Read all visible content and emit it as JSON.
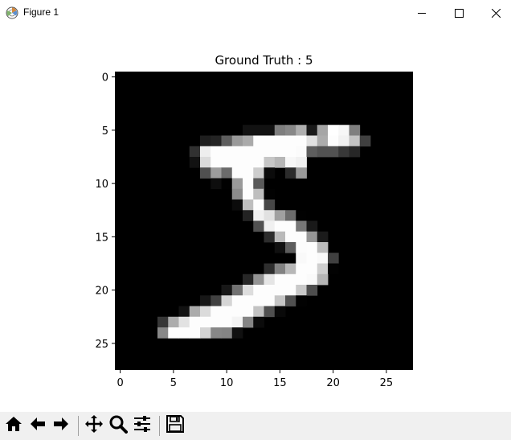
{
  "window": {
    "title": "Figure 1",
    "icons": {
      "app": "matplotlib-figure-icon",
      "minimize": "minimize-icon",
      "maximize": "maximize-icon",
      "close": "close-icon"
    }
  },
  "figure": {
    "title": "Ground Truth : 5"
  },
  "toolbar": {
    "buttons": [
      {
        "name": "home-icon"
      },
      {
        "name": "back-arrow-icon"
      },
      {
        "name": "forward-arrow-icon"
      },
      {
        "name": "pan-icon"
      },
      {
        "name": "zoom-icon"
      },
      {
        "name": "configure-subplots-icon"
      },
      {
        "name": "save-icon"
      }
    ]
  },
  "chart_data": {
    "type": "heatmap",
    "title": "Ground Truth : 5",
    "colormap": "gray",
    "shape": [
      28,
      28
    ],
    "xticks": [
      0,
      5,
      10,
      15,
      20,
      25
    ],
    "yticks": [
      0,
      5,
      10,
      15,
      20,
      25
    ],
    "xlim": [
      -0.5,
      27.5
    ],
    "ylim": [
      27.5,
      -0.5
    ],
    "grid": false,
    "background_value": 0,
    "nonzero_pixels": [
      {
        "row": 5,
        "col": 12,
        "v": 18
      },
      {
        "row": 5,
        "col": 13,
        "v": 18
      },
      {
        "row": 5,
        "col": 14,
        "v": 18
      },
      {
        "row": 5,
        "col": 15,
        "v": 126
      },
      {
        "row": 5,
        "col": 16,
        "v": 136
      },
      {
        "row": 5,
        "col": 17,
        "v": 175
      },
      {
        "row": 5,
        "col": 18,
        "v": 26
      },
      {
        "row": 5,
        "col": 19,
        "v": 166
      },
      {
        "row": 5,
        "col": 20,
        "v": 255
      },
      {
        "row": 5,
        "col": 21,
        "v": 247
      },
      {
        "row": 5,
        "col": 22,
        "v": 127
      },
      {
        "row": 6,
        "col": 8,
        "v": 30
      },
      {
        "row": 6,
        "col": 9,
        "v": 36
      },
      {
        "row": 6,
        "col": 10,
        "v": 94
      },
      {
        "row": 6,
        "col": 11,
        "v": 154
      },
      {
        "row": 6,
        "col": 12,
        "v": 170
      },
      {
        "row": 6,
        "col": 13,
        "v": 253
      },
      {
        "row": 6,
        "col": 14,
        "v": 253
      },
      {
        "row": 6,
        "col": 15,
        "v": 253
      },
      {
        "row": 6,
        "col": 16,
        "v": 253
      },
      {
        "row": 6,
        "col": 17,
        "v": 253
      },
      {
        "row": 6,
        "col": 18,
        "v": 225
      },
      {
        "row": 6,
        "col": 19,
        "v": 172
      },
      {
        "row": 6,
        "col": 20,
        "v": 253
      },
      {
        "row": 6,
        "col": 21,
        "v": 242
      },
      {
        "row": 6,
        "col": 22,
        "v": 195
      },
      {
        "row": 6,
        "col": 23,
        "v": 64
      },
      {
        "row": 7,
        "col": 7,
        "v": 49
      },
      {
        "row": 7,
        "col": 8,
        "v": 238
      },
      {
        "row": 7,
        "col": 9,
        "v": 253
      },
      {
        "row": 7,
        "col": 10,
        "v": 253
      },
      {
        "row": 7,
        "col": 11,
        "v": 253
      },
      {
        "row": 7,
        "col": 12,
        "v": 253
      },
      {
        "row": 7,
        "col": 13,
        "v": 253
      },
      {
        "row": 7,
        "col": 14,
        "v": 253
      },
      {
        "row": 7,
        "col": 15,
        "v": 253
      },
      {
        "row": 7,
        "col": 16,
        "v": 253
      },
      {
        "row": 7,
        "col": 17,
        "v": 251
      },
      {
        "row": 7,
        "col": 18,
        "v": 93
      },
      {
        "row": 7,
        "col": 19,
        "v": 82
      },
      {
        "row": 7,
        "col": 20,
        "v": 82
      },
      {
        "row": 7,
        "col": 21,
        "v": 56
      },
      {
        "row": 7,
        "col": 22,
        "v": 39
      },
      {
        "row": 8,
        "col": 7,
        "v": 18
      },
      {
        "row": 8,
        "col": 8,
        "v": 219
      },
      {
        "row": 8,
        "col": 9,
        "v": 253
      },
      {
        "row": 8,
        "col": 10,
        "v": 253
      },
      {
        "row": 8,
        "col": 11,
        "v": 253
      },
      {
        "row": 8,
        "col": 12,
        "v": 253
      },
      {
        "row": 8,
        "col": 13,
        "v": 253
      },
      {
        "row": 8,
        "col": 14,
        "v": 198
      },
      {
        "row": 8,
        "col": 15,
        "v": 182
      },
      {
        "row": 8,
        "col": 16,
        "v": 247
      },
      {
        "row": 8,
        "col": 17,
        "v": 241
      },
      {
        "row": 9,
        "col": 8,
        "v": 80
      },
      {
        "row": 9,
        "col": 9,
        "v": 156
      },
      {
        "row": 9,
        "col": 10,
        "v": 107
      },
      {
        "row": 9,
        "col": 11,
        "v": 253
      },
      {
        "row": 9,
        "col": 12,
        "v": 253
      },
      {
        "row": 9,
        "col": 13,
        "v": 205
      },
      {
        "row": 9,
        "col": 14,
        "v": 11
      },
      {
        "row": 9,
        "col": 16,
        "v": 43
      },
      {
        "row": 9,
        "col": 17,
        "v": 154
      },
      {
        "row": 10,
        "col": 9,
        "v": 14
      },
      {
        "row": 10,
        "col": 10,
        "v": 1
      },
      {
        "row": 10,
        "col": 11,
        "v": 154
      },
      {
        "row": 10,
        "col": 12,
        "v": 253
      },
      {
        "row": 10,
        "col": 13,
        "v": 90
      },
      {
        "row": 11,
        "col": 11,
        "v": 139
      },
      {
        "row": 11,
        "col": 12,
        "v": 253
      },
      {
        "row": 11,
        "col": 13,
        "v": 190
      },
      {
        "row": 11,
        "col": 14,
        "v": 2
      },
      {
        "row": 12,
        "col": 11,
        "v": 11
      },
      {
        "row": 12,
        "col": 12,
        "v": 190
      },
      {
        "row": 12,
        "col": 13,
        "v": 253
      },
      {
        "row": 12,
        "col": 14,
        "v": 70
      },
      {
        "row": 13,
        "col": 12,
        "v": 35
      },
      {
        "row": 13,
        "col": 13,
        "v": 241
      },
      {
        "row": 13,
        "col": 14,
        "v": 225
      },
      {
        "row": 13,
        "col": 15,
        "v": 160
      },
      {
        "row": 13,
        "col": 16,
        "v": 108
      },
      {
        "row": 13,
        "col": 17,
        "v": 1
      },
      {
        "row": 14,
        "col": 13,
        "v": 81
      },
      {
        "row": 14,
        "col": 14,
        "v": 240
      },
      {
        "row": 14,
        "col": 15,
        "v": 253
      },
      {
        "row": 14,
        "col": 16,
        "v": 253
      },
      {
        "row": 14,
        "col": 17,
        "v": 119
      },
      {
        "row": 14,
        "col": 18,
        "v": 25
      },
      {
        "row": 15,
        "col": 14,
        "v": 45
      },
      {
        "row": 15,
        "col": 15,
        "v": 186
      },
      {
        "row": 15,
        "col": 16,
        "v": 253
      },
      {
        "row": 15,
        "col": 17,
        "v": 253
      },
      {
        "row": 15,
        "col": 18,
        "v": 150
      },
      {
        "row": 15,
        "col": 19,
        "v": 27
      },
      {
        "row": 16,
        "col": 15,
        "v": 16
      },
      {
        "row": 16,
        "col": 16,
        "v": 93
      },
      {
        "row": 16,
        "col": 17,
        "v": 252
      },
      {
        "row": 16,
        "col": 18,
        "v": 253
      },
      {
        "row": 16,
        "col": 19,
        "v": 187
      },
      {
        "row": 17,
        "col": 17,
        "v": 249
      },
      {
        "row": 17,
        "col": 18,
        "v": 253
      },
      {
        "row": 17,
        "col": 19,
        "v": 249
      },
      {
        "row": 17,
        "col": 20,
        "v": 64
      },
      {
        "row": 18,
        "col": 14,
        "v": 46
      },
      {
        "row": 18,
        "col": 15,
        "v": 130
      },
      {
        "row": 18,
        "col": 16,
        "v": 183
      },
      {
        "row": 18,
        "col": 17,
        "v": 253
      },
      {
        "row": 18,
        "col": 18,
        "v": 253
      },
      {
        "row": 18,
        "col": 19,
        "v": 207
      },
      {
        "row": 18,
        "col": 20,
        "v": 2
      },
      {
        "row": 19,
        "col": 12,
        "v": 39
      },
      {
        "row": 19,
        "col": 13,
        "v": 148
      },
      {
        "row": 19,
        "col": 14,
        "v": 229
      },
      {
        "row": 19,
        "col": 15,
        "v": 253
      },
      {
        "row": 19,
        "col": 16,
        "v": 253
      },
      {
        "row": 19,
        "col": 17,
        "v": 253
      },
      {
        "row": 19,
        "col": 18,
        "v": 250
      },
      {
        "row": 19,
        "col": 19,
        "v": 182
      },
      {
        "row": 20,
        "col": 10,
        "v": 24
      },
      {
        "row": 20,
        "col": 11,
        "v": 114
      },
      {
        "row": 20,
        "col": 12,
        "v": 221
      },
      {
        "row": 20,
        "col": 13,
        "v": 253
      },
      {
        "row": 20,
        "col": 14,
        "v": 253
      },
      {
        "row": 20,
        "col": 15,
        "v": 253
      },
      {
        "row": 20,
        "col": 16,
        "v": 253
      },
      {
        "row": 20,
        "col": 17,
        "v": 201
      },
      {
        "row": 20,
        "col": 18,
        "v": 78
      },
      {
        "row": 21,
        "col": 8,
        "v": 23
      },
      {
        "row": 21,
        "col": 9,
        "v": 66
      },
      {
        "row": 21,
        "col": 10,
        "v": 213
      },
      {
        "row": 21,
        "col": 11,
        "v": 253
      },
      {
        "row": 21,
        "col": 12,
        "v": 253
      },
      {
        "row": 21,
        "col": 13,
        "v": 253
      },
      {
        "row": 21,
        "col": 14,
        "v": 253
      },
      {
        "row": 21,
        "col": 15,
        "v": 198
      },
      {
        "row": 21,
        "col": 16,
        "v": 81
      },
      {
        "row": 21,
        "col": 17,
        "v": 2
      },
      {
        "row": 22,
        "col": 6,
        "v": 18
      },
      {
        "row": 22,
        "col": 7,
        "v": 171
      },
      {
        "row": 22,
        "col": 8,
        "v": 219
      },
      {
        "row": 22,
        "col": 9,
        "v": 253
      },
      {
        "row": 22,
        "col": 10,
        "v": 253
      },
      {
        "row": 22,
        "col": 11,
        "v": 253
      },
      {
        "row": 22,
        "col": 12,
        "v": 253
      },
      {
        "row": 22,
        "col": 13,
        "v": 195
      },
      {
        "row": 22,
        "col": 14,
        "v": 80
      },
      {
        "row": 22,
        "col": 15,
        "v": 9
      },
      {
        "row": 23,
        "col": 4,
        "v": 55
      },
      {
        "row": 23,
        "col": 5,
        "v": 172
      },
      {
        "row": 23,
        "col": 6,
        "v": 226
      },
      {
        "row": 23,
        "col": 7,
        "v": 253
      },
      {
        "row": 23,
        "col": 8,
        "v": 253
      },
      {
        "row": 23,
        "col": 9,
        "v": 253
      },
      {
        "row": 23,
        "col": 10,
        "v": 253
      },
      {
        "row": 23,
        "col": 11,
        "v": 244
      },
      {
        "row": 23,
        "col": 12,
        "v": 133
      },
      {
        "row": 23,
        "col": 13,
        "v": 11
      },
      {
        "row": 24,
        "col": 4,
        "v": 136
      },
      {
        "row": 24,
        "col": 5,
        "v": 253
      },
      {
        "row": 24,
        "col": 6,
        "v": 253
      },
      {
        "row": 24,
        "col": 7,
        "v": 253
      },
      {
        "row": 24,
        "col": 8,
        "v": 212
      },
      {
        "row": 24,
        "col": 9,
        "v": 135
      },
      {
        "row": 24,
        "col": 10,
        "v": 132
      },
      {
        "row": 24,
        "col": 11,
        "v": 16
      }
    ]
  }
}
